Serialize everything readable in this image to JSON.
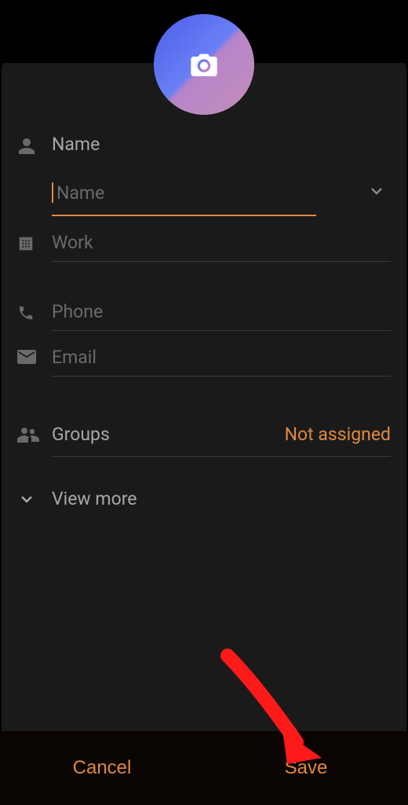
{
  "fields": {
    "name_label": "Name",
    "name_placeholder": "Name",
    "work_label": "Work",
    "phone_label": "Phone",
    "email_label": "Email",
    "groups_label": "Groups",
    "groups_value": "Not assigned",
    "view_more": "View more"
  },
  "buttons": {
    "cancel": "Cancel",
    "save": "Save"
  }
}
